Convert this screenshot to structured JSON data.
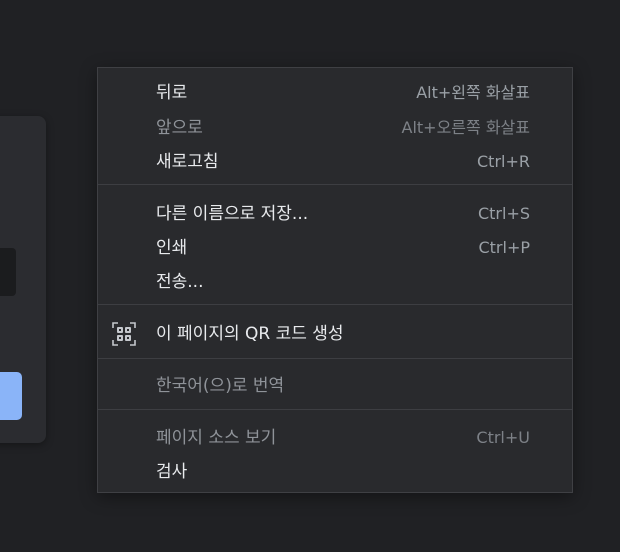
{
  "menu": {
    "items": [
      {
        "label": "뒤로",
        "shortcut": "Alt+왼쪽 화살표",
        "enabled": true
      },
      {
        "label": "앞으로",
        "shortcut": "Alt+오른쪽 화살표",
        "enabled": false
      },
      {
        "label": "새로고침",
        "shortcut": "Ctrl+R",
        "enabled": true
      },
      {
        "label": "다른 이름으로 저장...",
        "shortcut": "Ctrl+S",
        "enabled": true
      },
      {
        "label": "인쇄",
        "shortcut": "Ctrl+P",
        "enabled": true
      },
      {
        "label": "전송...",
        "shortcut": "",
        "enabled": true
      },
      {
        "label": "이 페이지의 QR 코드 생성",
        "shortcut": "",
        "icon": "qr-code-icon",
        "enabled": true
      },
      {
        "label": "한국어(으)로 번역",
        "shortcut": "",
        "enabled": false
      },
      {
        "label": "페이지 소스 보기",
        "shortcut": "Ctrl+U",
        "enabled": false
      },
      {
        "label": "검사",
        "shortcut": "",
        "enabled": true
      }
    ]
  },
  "colors": {
    "background": "#202124",
    "menu_background": "#292a2d",
    "text": "#e8eaed",
    "text_disabled": "#8f9399",
    "accent_button": "#8ab4f8"
  }
}
